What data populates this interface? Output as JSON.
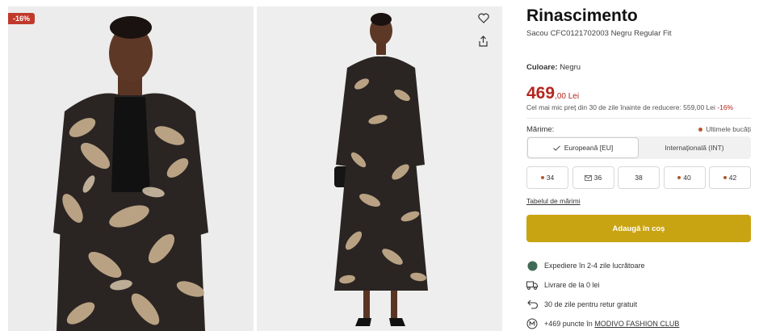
{
  "gallery": {
    "discount_badge": "-16%",
    "images": [
      {
        "icon": "model-front-closeup-image"
      },
      {
        "icon": "model-full-body-image"
      }
    ],
    "wishlist_icon": "heart-icon",
    "share_icon": "share-icon"
  },
  "product": {
    "brand": "Rinascimento",
    "subtitle": "Sacou CFC0121702003 Negru Regular Fit",
    "color_label": "Culoare:",
    "color_value": "Negru",
    "price_int": "469",
    "price_dec": ",00 Lei",
    "lowest_price_text": "Cel mai mic preț din 30 de zile înainte de reducere: 559,00 Lei",
    "lowest_price_pct": "-16%",
    "accent_color": "#b3261e"
  },
  "sizes": {
    "label": "Mărime:",
    "last_items": "Ultimele bucăți",
    "system_eu": "Europeană [EU]",
    "system_int": "Internațională (INT)",
    "options": [
      {
        "label": "34",
        "status": "last-items"
      },
      {
        "label": "36",
        "status": "notify"
      },
      {
        "label": "38",
        "status": "available"
      },
      {
        "label": "40",
        "status": "last-items"
      },
      {
        "label": "42",
        "status": "last-items"
      }
    ],
    "size_table_link": "Tabelul de mărimi"
  },
  "cart": {
    "add_label": "Adaugă în coș",
    "button_color": "#c9a412"
  },
  "perks": [
    {
      "icon": "green-dot-icon",
      "text": "Expediere în 2-4 zile lucrătoare"
    },
    {
      "icon": "truck-icon",
      "text": "Livrare de la 0 lei"
    },
    {
      "icon": "return-arrow-icon",
      "text": "30 de zile pentru retur gratuit"
    },
    {
      "icon": "modivo-club-icon",
      "text": "+469 puncte în ",
      "link": "MODIVO FASHION CLUB"
    }
  ]
}
